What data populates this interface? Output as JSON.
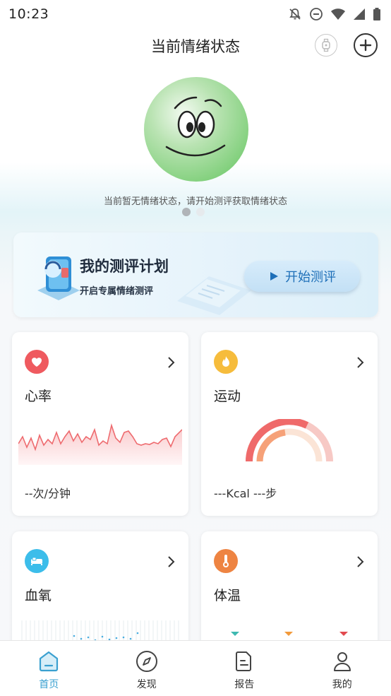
{
  "status_bar": {
    "time": "10:23",
    "icons": [
      "bell-off-icon",
      "do-not-disturb-icon",
      "wifi-icon",
      "signal-icon",
      "battery-icon"
    ]
  },
  "header": {
    "title": "当前情绪状态",
    "right_icons": [
      "watch-icon",
      "add-icon"
    ]
  },
  "emotion": {
    "face_icon": "smiling-face-icon",
    "face_color": "#7fcf7a",
    "hint": "当前暂无情绪状态，请开始测评获取情绪状态",
    "carousel_pages": 2,
    "active_page": 1
  },
  "banner": {
    "title": "我的测评计划",
    "subtitle": "开启专属情绪测评",
    "button_label": "开始测评",
    "button_icon": "play-icon"
  },
  "cards": [
    {
      "key": "heart",
      "title": "心率",
      "value": "--次/分钟",
      "icon": "heart-icon",
      "icon_color": "#ef5a5f"
    },
    {
      "key": "exercise",
      "title": "运动",
      "value": "---Kcal ---步",
      "icon": "fire-icon",
      "icon_color": "#f6bc3c"
    },
    {
      "key": "oxygen",
      "title": "血氧",
      "value": "",
      "icon": "bed-icon",
      "icon_color": "#3cbdea"
    },
    {
      "key": "temperature",
      "title": "体温",
      "value": "",
      "icon": "thermometer-icon",
      "icon_color": "#ee8442"
    }
  ],
  "nav": {
    "items": [
      {
        "label": "首页",
        "icon": "home-icon",
        "active": true
      },
      {
        "label": "发现",
        "icon": "compass-icon",
        "active": false
      },
      {
        "label": "报告",
        "icon": "report-icon",
        "active": false
      },
      {
        "label": "我的",
        "icon": "profile-icon",
        "active": false
      }
    ],
    "active_color": "#3aa0d0"
  }
}
